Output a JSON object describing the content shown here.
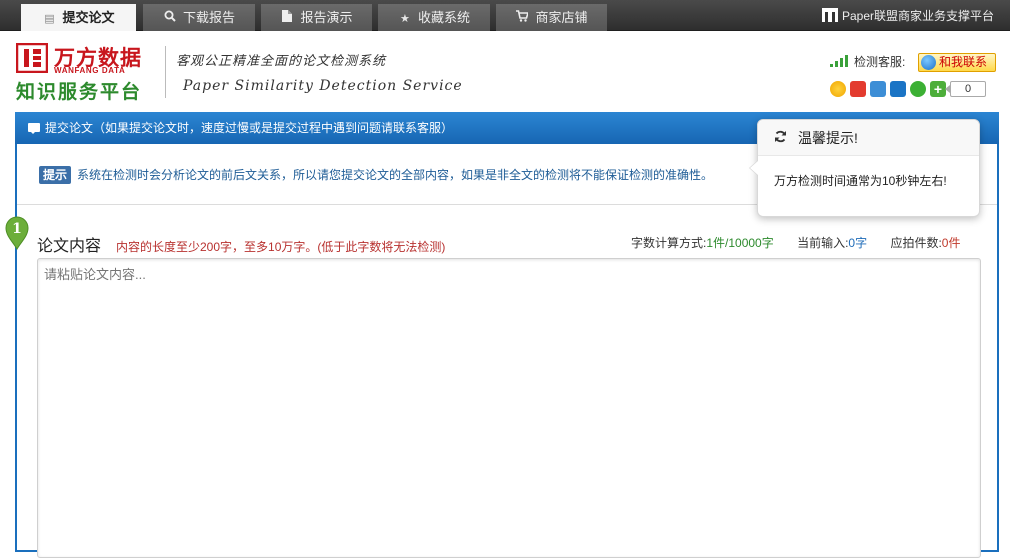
{
  "nav": {
    "tabs": [
      {
        "label": "提交论文",
        "icon": "document-icon",
        "active": true
      },
      {
        "label": "下载报告",
        "icon": "search-icon",
        "active": false
      },
      {
        "label": "报告演示",
        "icon": "file-icon",
        "active": false
      },
      {
        "label": "收藏系统",
        "icon": "star-icon",
        "active": false
      },
      {
        "label": "商家店铺",
        "icon": "cart-icon",
        "active": false
      }
    ],
    "right_text": "Paper联盟商家业务支撑平台"
  },
  "header": {
    "logo_cn": "万方数据",
    "logo_en": "WANFANG DATA",
    "platform": "知识服务平台",
    "slogan_cn": "客观公正精准全面的论文检测系统",
    "slogan_en": "Paper Similarity Detection Service",
    "service_label": "检测客服:",
    "contact_label": "和我联系",
    "share_count": "0"
  },
  "panel": {
    "title": "提交论文（如果提交论文时，速度过慢或是提交过程中遇到问题请联系客服）",
    "tip_label": "提示",
    "tip_text": "系统在检测时会分析论文的前后文关系，所以请您提交论文的全部内容，如果是非全文的检测将不能保证检测的准确性。",
    "step_number": "1",
    "section_title": "论文内容",
    "section_note": "内容的长度至少200字，至多10万字。(低于此字数将无法检测)",
    "stats": {
      "method_label": "字数计算方式:",
      "method_value": "1件/10000字",
      "current_label": "当前输入:",
      "current_value": "0字",
      "pieces_label": "应拍件数:",
      "pieces_value": "0件"
    },
    "textarea_placeholder": "请粘贴论文内容..."
  },
  "popover": {
    "title": "温馨提示!",
    "body": "万方检测时间通常为10秒钟左右!"
  },
  "colors": {
    "primary_blue": "#1766b3",
    "brand_red": "#c8161d",
    "brand_green": "#2d8a2d",
    "note_red": "#b8312f"
  }
}
